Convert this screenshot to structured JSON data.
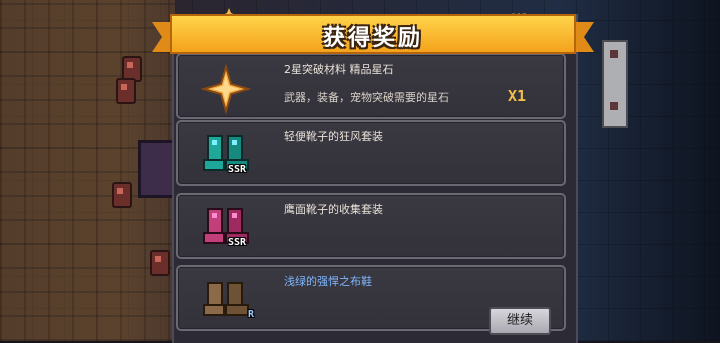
{
  "title": "获得奖励",
  "top_partial_qty": "X1",
  "rewards": [
    {
      "name": "2星突破材料 精品星石",
      "description": "武器，装备，宠物突破需要的星石",
      "quantity": "X1",
      "icon": "gold-star-icon",
      "rarity": ""
    },
    {
      "name": "轻便靴子的狂风套装",
      "description": "",
      "quantity": "",
      "icon": "teal-boots-icon",
      "rarity": "SSR",
      "color": "#1fa89a"
    },
    {
      "name": "鹰面靴子的收集套装",
      "description": "",
      "quantity": "",
      "icon": "magenta-boots-icon",
      "rarity": "SSR",
      "color": "#b8336f"
    },
    {
      "name": "浅绿的强悍之布鞋",
      "description": "",
      "quantity": "",
      "icon": "brown-boots-icon",
      "rarity": "R",
      "color": "#8a6a48"
    }
  ],
  "continue_label": "继续",
  "colors": {
    "banner": "#f4a21c",
    "quantity": "#f2c04a",
    "name_blue": "#7fb7ff"
  }
}
